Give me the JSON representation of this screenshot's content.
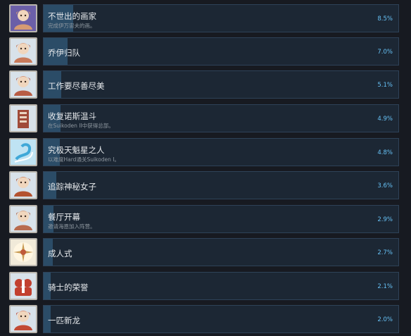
{
  "achievements": [
    {
      "title": "不世出的画家",
      "description": "完成伊万宙夫的画。",
      "percent": "8.5%",
      "rate": 8.5,
      "icon": "painter-portrait-icon",
      "icon_bg": "#6b5fa8",
      "icon_fg": "#d59a73"
    },
    {
      "title": "乔伊归队",
      "description": "",
      "percent": "7.0%",
      "rate": 7.0,
      "icon": "character-portrait-icon",
      "icon_bg": "#d8e2ea",
      "icon_fg": "#c87a5a"
    },
    {
      "title": "工作要尽善尽美",
      "description": "",
      "percent": "5.1%",
      "rate": 5.1,
      "icon": "character-portrait-icon",
      "icon_bg": "#d8e2ea",
      "icon_fg": "#b85c44"
    },
    {
      "title": "收复诺斯温斗",
      "description": "在Suikoden II中获得总部。",
      "percent": "4.9%",
      "rate": 4.9,
      "icon": "castle-icon",
      "icon_bg": "#d8e2ea",
      "icon_fg": "#a04a38"
    },
    {
      "title": "究极天魁星之人",
      "description": "以难度Hard通关Suikoden I。",
      "percent": "4.8%",
      "rate": 4.8,
      "icon": "water-swirl-icon",
      "icon_bg": "#bfe3f3",
      "icon_fg": "#3fa8d8"
    },
    {
      "title": "追踪神秘女子",
      "description": "",
      "percent": "3.6%",
      "rate": 3.6,
      "icon": "character-portrait-icon",
      "icon_bg": "#d8e2ea",
      "icon_fg": "#b4522f"
    },
    {
      "title": "餐厅开幕",
      "description": "邀请海恩加入阵营。",
      "percent": "2.9%",
      "rate": 2.9,
      "icon": "chef-portrait-icon",
      "icon_bg": "#d8e2ea",
      "icon_fg": "#b86b4e"
    },
    {
      "title": "成人式",
      "description": "",
      "percent": "2.7%",
      "rate": 2.7,
      "icon": "ceremony-icon",
      "icon_bg": "#f1ead9",
      "icon_fg": "#c89a52"
    },
    {
      "title": "骑士的荣誉",
      "description": "",
      "percent": "2.1%",
      "rate": 2.1,
      "icon": "knights-icon",
      "icon_bg": "#d8e2ea",
      "icon_fg": "#c2402f"
    },
    {
      "title": "一匹新龙",
      "description": "",
      "percent": "2.0%",
      "rate": 2.0,
      "icon": "dragon-rider-icon",
      "icon_bg": "#d8e2ea",
      "icon_fg": "#c24a34"
    }
  ]
}
